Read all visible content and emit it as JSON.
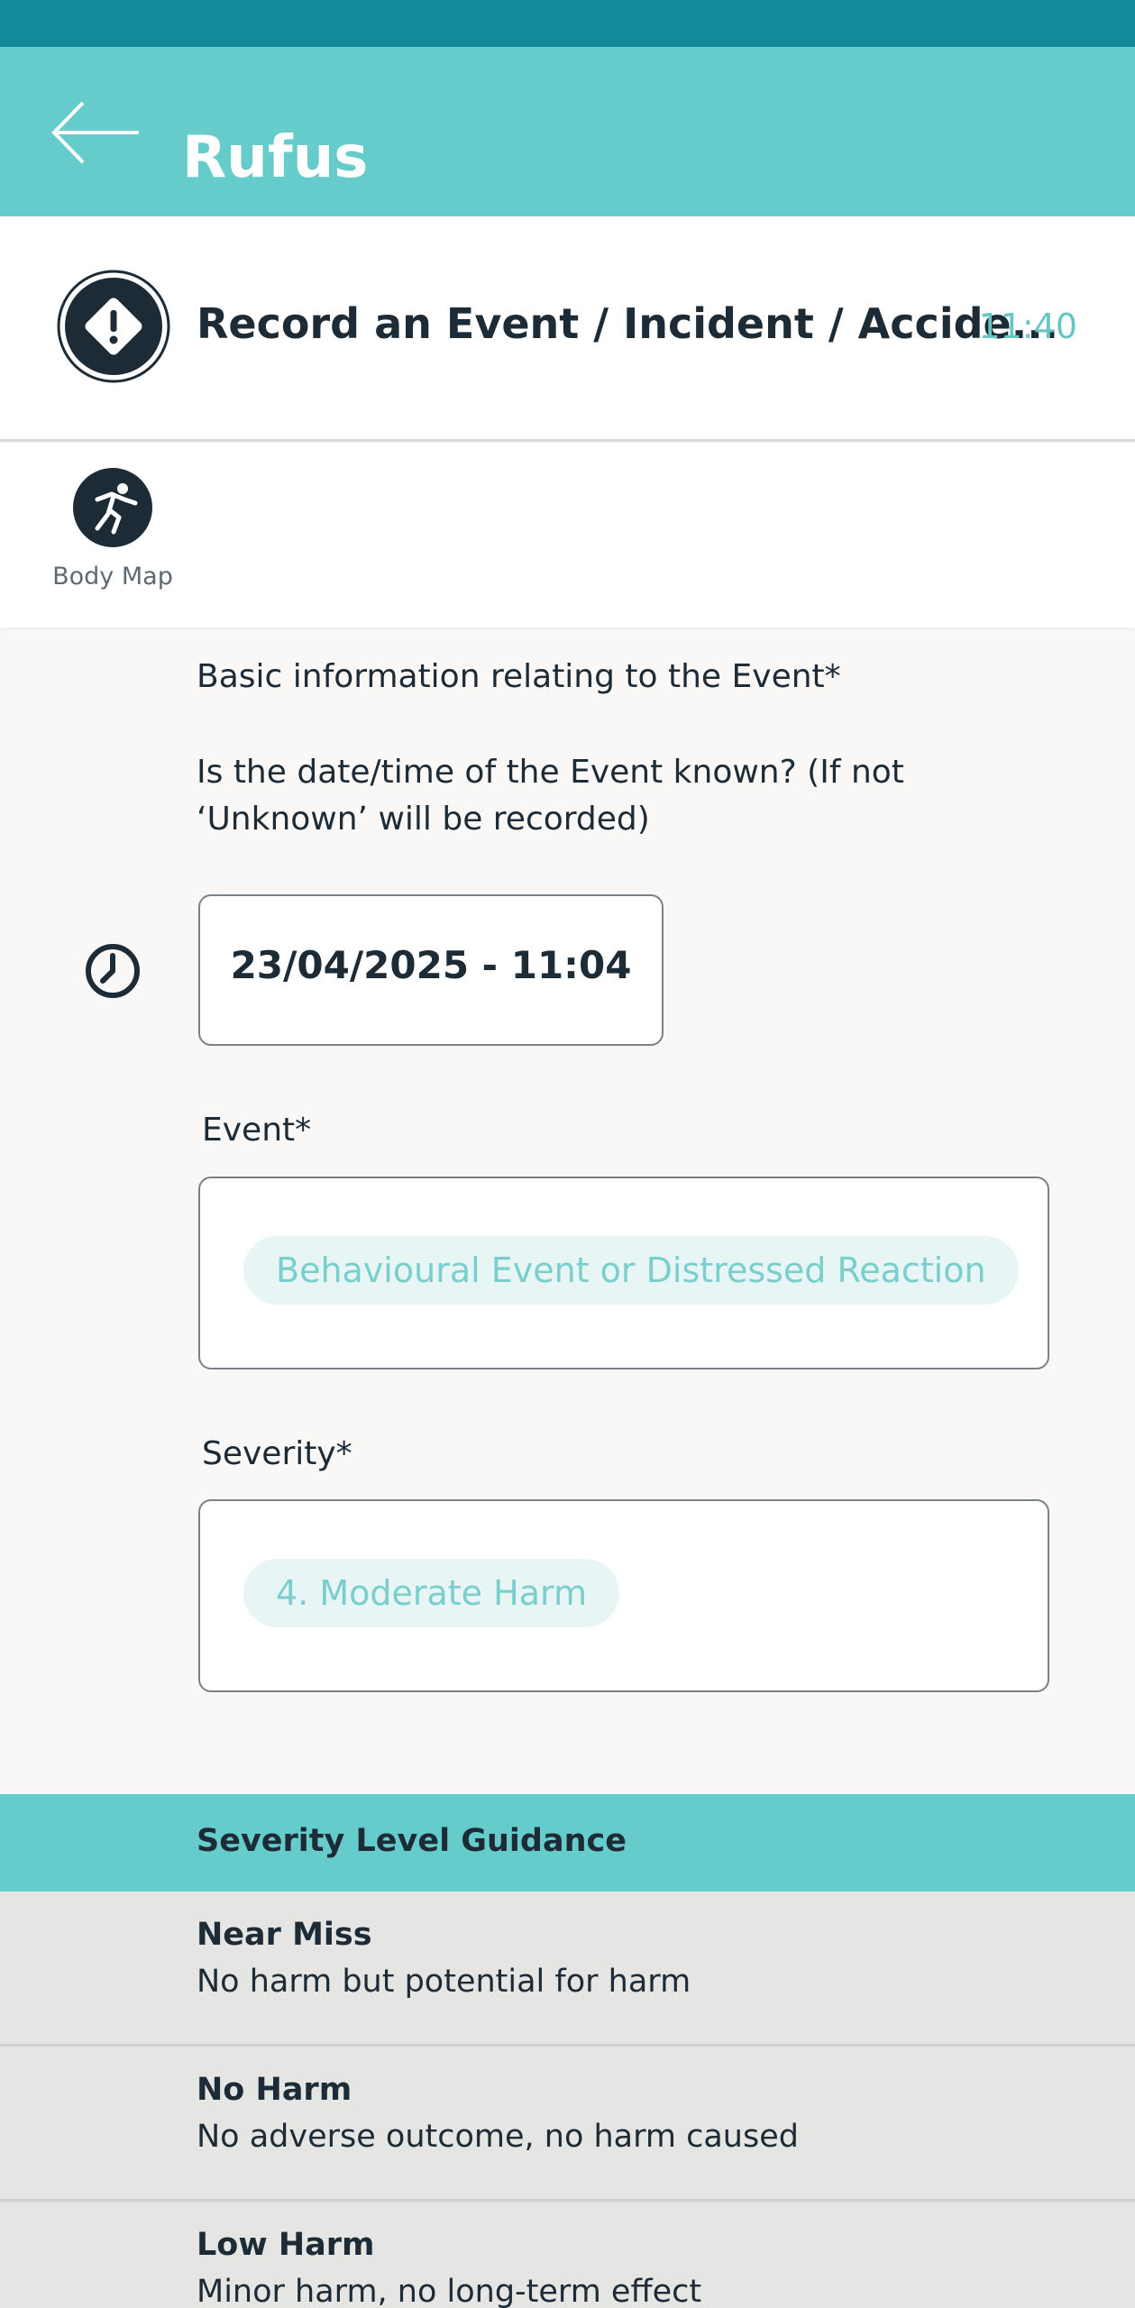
{
  "header": {
    "title": "Rufus"
  },
  "record": {
    "title": "Record an Event / Incident / Accide...",
    "time": "11:40"
  },
  "tools": {
    "body_map_label": "Body Map"
  },
  "form": {
    "section_title": "Basic information relating to the Event*",
    "date_question_line1": "Is the date/time of the Event known? (If not",
    "date_question_line2": "‘Unknown’ will be recorded)",
    "date_value": "23/04/2025 - 11:04",
    "event_label": "Event*",
    "event_value": "Behavioural Event or Distressed Reaction",
    "severity_label": "Severity*",
    "severity_value": "4. Moderate Harm"
  },
  "guidance": {
    "title": "Severity Level Guidance",
    "items": [
      {
        "title": "Near Miss",
        "description": "No harm but potential for harm"
      },
      {
        "title": "No Harm",
        "description": "No adverse outcome, no harm caused"
      },
      {
        "title": "Low Harm",
        "description": "Minor harm, no long-term effect"
      }
    ]
  },
  "colors": {
    "status_bar": "#13899b",
    "header": "#66cccb",
    "accent_text": "#66c6c6",
    "dark_text": "#1c2b36"
  }
}
